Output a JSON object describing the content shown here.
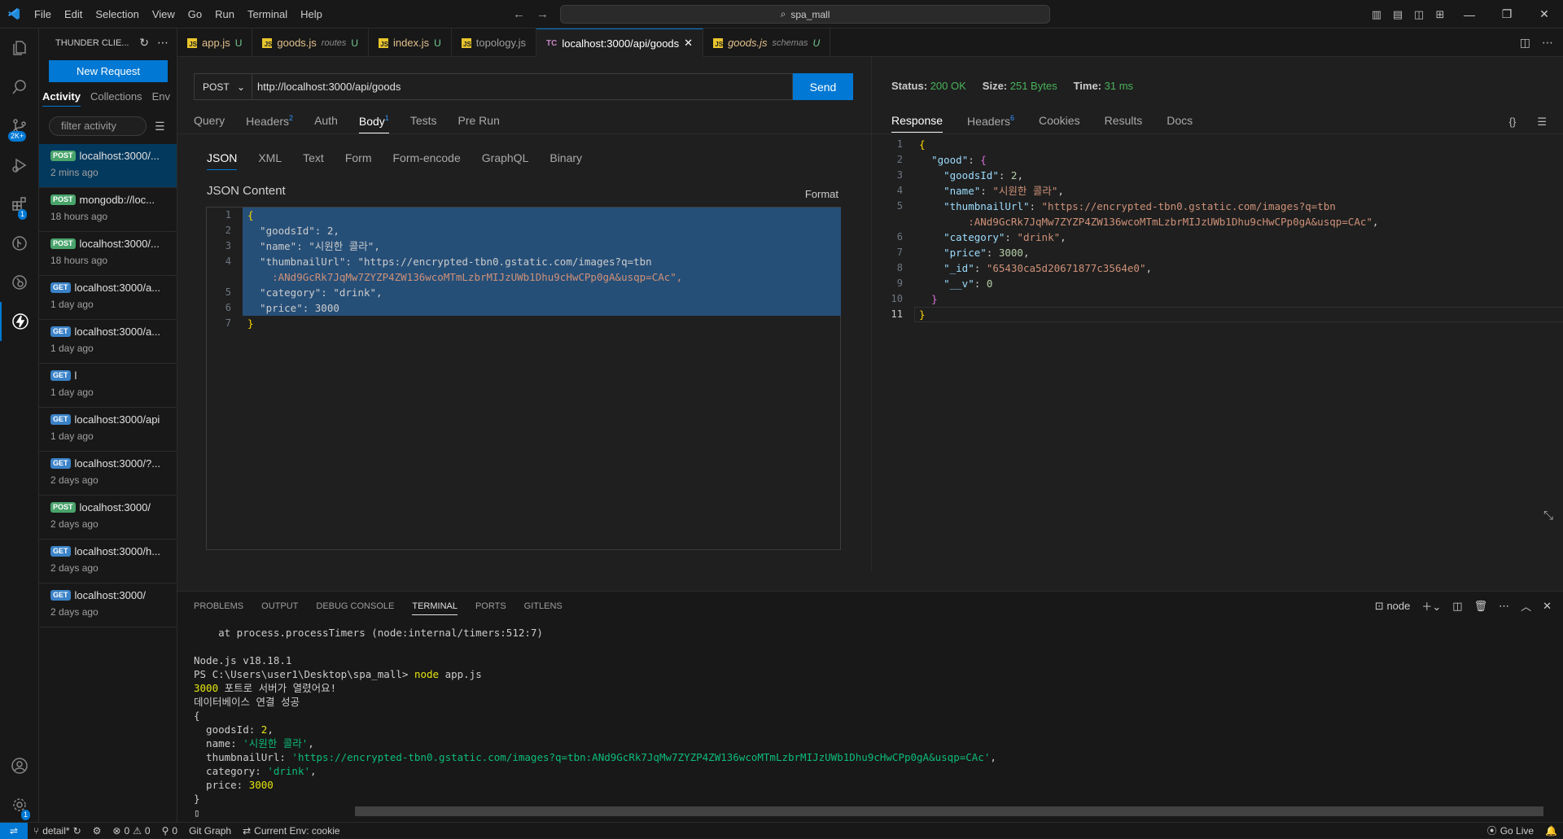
{
  "titlebar": {
    "menu": [
      "File",
      "Edit",
      "Selection",
      "View",
      "Go",
      "Run",
      "Terminal",
      "Help"
    ],
    "search": "spa_mall"
  },
  "activitybar": {
    "badges": {
      "source_control": "2K+",
      "extensions": "1",
      "settings": "1"
    }
  },
  "sidebar": {
    "title": "THUNDER CLIE...",
    "new_request": "New Request",
    "tabs": [
      "Activity",
      "Collections",
      "Env"
    ],
    "filter_placeholder": "filter activity",
    "items": [
      {
        "method": "POST",
        "url": "localhost:3000/...",
        "time": "2 mins ago"
      },
      {
        "method": "POST",
        "url": "mongodb://loc...",
        "time": "18 hours ago"
      },
      {
        "method": "POST",
        "url": "localhost:3000/...",
        "time": "18 hours ago"
      },
      {
        "method": "GET",
        "url": "localhost:3000/a...",
        "time": "1 day ago"
      },
      {
        "method": "GET",
        "url": "localhost:3000/a...",
        "time": "1 day ago"
      },
      {
        "method": "GET",
        "url": "l",
        "time": "1 day ago"
      },
      {
        "method": "GET",
        "url": "localhost:3000/api",
        "time": "1 day ago"
      },
      {
        "method": "GET",
        "url": "localhost:3000/?...",
        "time": "2 days ago"
      },
      {
        "method": "POST",
        "url": "localhost:3000/",
        "time": "2 days ago"
      },
      {
        "method": "GET",
        "url": "localhost:3000/h...",
        "time": "2 days ago"
      },
      {
        "method": "GET",
        "url": "localhost:3000/",
        "time": "2 days ago"
      }
    ]
  },
  "tabs": [
    {
      "label": "app.js",
      "sub": "",
      "status": "U"
    },
    {
      "label": "goods.js",
      "sub": "routes",
      "status": "U"
    },
    {
      "label": "index.js",
      "sub": "",
      "status": "U"
    },
    {
      "label": "topology.js",
      "sub": "",
      "status": ""
    },
    {
      "label": "localhost:3000/api/goods",
      "sub": "",
      "status": ""
    },
    {
      "label": "goods.js",
      "sub": "schemas",
      "status": "U"
    }
  ],
  "request": {
    "method": "POST",
    "url": "http://localhost:3000/api/goods",
    "send": "Send",
    "tabs": [
      "Query",
      "Headers",
      "Auth",
      "Body",
      "Tests",
      "Pre Run"
    ],
    "headers_count": "2",
    "body_count": "1",
    "body_tabs": [
      "JSON",
      "XML",
      "Text",
      "Form",
      "Form-encode",
      "GraphQL",
      "Binary"
    ],
    "json_label": "JSON Content",
    "format": "Format",
    "body_lines": [
      "{",
      "  \"goodsId\": 2,",
      "  \"name\": \"시원한 콜라\",",
      "  \"thumbnailUrl\": \"https://encrypted-tbn0.gstatic.com/images?q=tbn",
      "    :ANd9GcRk7JqMw7ZYZP4ZW136wcoMTmLzbrMIJzUWb1Dhu9cHwCPp0gA&usqp=CAc\",",
      "  \"category\": \"drink\",",
      "  \"price\": 3000",
      "}"
    ]
  },
  "response": {
    "status_label": "Status:",
    "status": "200 OK",
    "size_label": "Size:",
    "size": "251 Bytes",
    "time_label": "Time:",
    "time": "31 ms",
    "tabs": [
      "Response",
      "Headers",
      "Cookies",
      "Results",
      "Docs"
    ],
    "headers_count": "6",
    "body": {
      "goodsId": "2",
      "name": "\"시원한 콜라\"",
      "thumb1": "\"https://encrypted-tbn0.gstatic.com/images?q=tbn",
      "thumb2": ":ANd9GcRk7JqMw7ZYZP4ZW136wcoMTmLzbrMIJzUWb1Dhu9cHwCPp0gA&usqp=CAc\"",
      "category": "\"drink\"",
      "price": "3000",
      "id": "\"65430ca5d20671877c3564e0\"",
      "v": "0"
    }
  },
  "panel": {
    "tabs": [
      "PROBLEMS",
      "OUTPUT",
      "DEBUG CONSOLE",
      "TERMINAL",
      "PORTS",
      "GITLENS"
    ],
    "shell": "node",
    "terminal": {
      "l1": "    at process.processTimers (node:internal/timers:512:7)",
      "l2": "Node.js v18.18.1",
      "prompt": "PS C:\\Users\\user1\\Desktop\\spa_mall> ",
      "cmd": "node",
      "cmd_arg": " app.js",
      "port_num": "3000",
      "port_msg": " 포트로 서버가 열렸어요!",
      "db": "데이터베이스 연결 성공",
      "open": "{",
      "k_goodsId": "  goodsId: ",
      "v_goodsId": "2",
      "k_name": "  name: ",
      "v_name": "'시원한 콜라'",
      "k_thumb": "  thumbnailUrl: ",
      "v_thumb": "'https://encrypted-tbn0.gstatic.com/images?q=tbn:ANd9GcRk7JqMw7ZYZP4ZW136wcoMTmLzbrMIJzUWb1Dhu9cHwCPp0gA&usqp=CAc'",
      "k_cat": "  category: ",
      "v_cat": "'drink'",
      "k_price": "  price: ",
      "v_price": "3000",
      "close": "}",
      "comma": ","
    }
  },
  "statusbar": {
    "branch": "detail*",
    "errors": "0",
    "warnings": "0",
    "ports": "0",
    "git_graph": "Git Graph",
    "env": "Current Env: cookie",
    "golive": "Go Live"
  }
}
